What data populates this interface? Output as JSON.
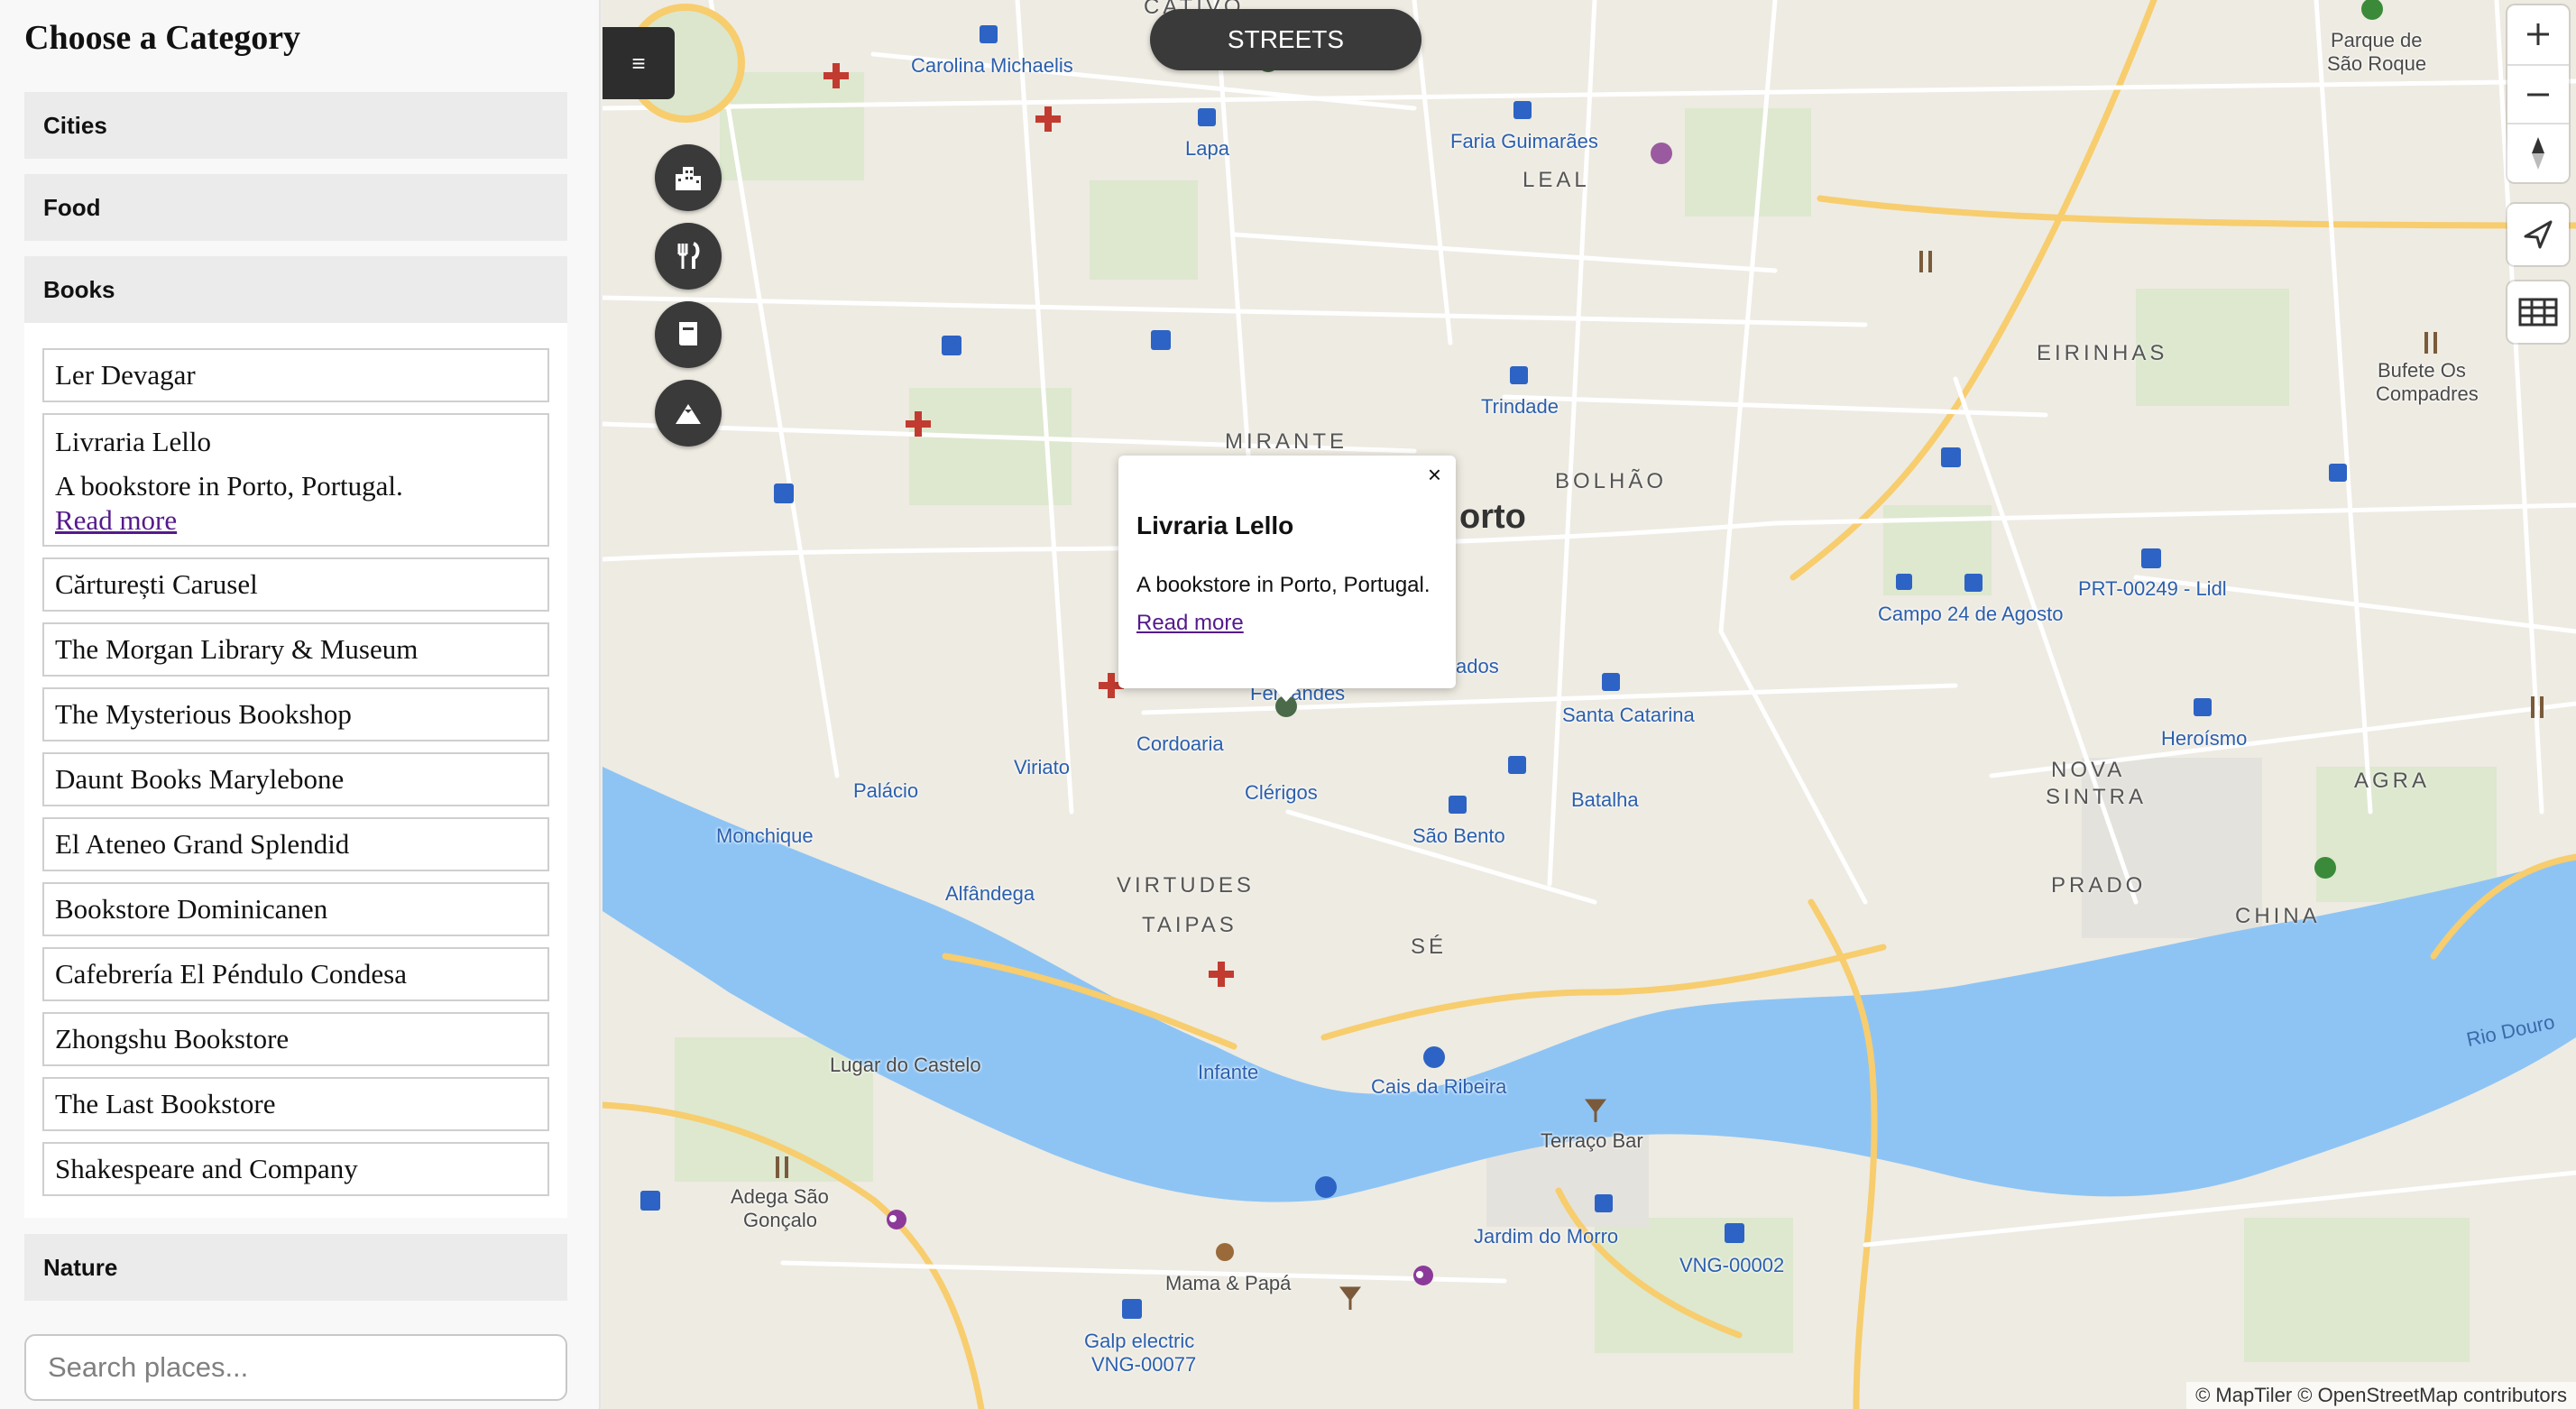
{
  "sidebar": {
    "title": "Choose a Category",
    "categories": {
      "cities": "Cities",
      "food": "Food",
      "books": "Books",
      "nature": "Nature"
    },
    "books": [
      {
        "name": "Ler Devagar"
      },
      {
        "name": "Livraria Lello",
        "description": "A bookstore in Porto, Portugal.",
        "link": "Read more"
      },
      {
        "name": "Cărturești Carusel"
      },
      {
        "name": "The Morgan Library & Museum"
      },
      {
        "name": "The Mysterious Bookshop"
      },
      {
        "name": "Daunt Books Marylebone"
      },
      {
        "name": "El Ateneo Grand Splendid"
      },
      {
        "name": "Bookstore Dominicanen"
      },
      {
        "name": "Cafebrería El Péndulo Condesa"
      },
      {
        "name": "Zhongshu Bookstore"
      },
      {
        "name": "The Last Bookstore"
      },
      {
        "name": "Shakespeare and Company"
      }
    ],
    "search_placeholder": "Search places..."
  },
  "map": {
    "style_button": "STREETS",
    "menu_icon": "hamburger-icon",
    "category_buttons": [
      "cities-icon",
      "food-icon",
      "books-icon",
      "nature-icon"
    ],
    "controls": [
      "zoom-in-icon",
      "zoom-out-icon",
      "compass-icon",
      "geolocate-icon",
      "grid-icon"
    ],
    "popup": {
      "title": "Livraria Lello",
      "description": "A bookstore in Porto, Portugal.",
      "link": "Read more",
      "close": "×"
    },
    "attribution": "© MapTiler © OpenStreetMap contributors",
    "labels": {
      "carolina": "Carolina Michaelis",
      "lapa": "Lapa",
      "faria": "Faria Guimarães",
      "leal": "LEAL",
      "parque": "Parque de",
      "saoroque": "São Roque",
      "eirinhas": "EIRINHAS",
      "bufete1": "Bufete Os",
      "bufete2": "Compadres",
      "trindade": "Trindade",
      "mirante": "MIRANTE",
      "bolhao": "BOLHÃO",
      "porto": "orto",
      "prt": "PRT-00249 - Lidl",
      "campo": "Campo 24 de Agosto",
      "aliados": "ados",
      "fernandes": "Fernandes",
      "santacat": "Santa Catarina",
      "heroismo": "Heroísmo",
      "novasintra1": "NOVA",
      "novasintra2": "SINTRA",
      "agra": "AGRA",
      "cordoaria": "Cordoaria",
      "viriato": "Viriato",
      "palacio": "Palácio",
      "clerigos": "Clérigos",
      "batalha": "Batalha",
      "monchique": "Monchique",
      "saobento": "São Bento",
      "alfandega": "Alfândega",
      "virtudes": "VIRTUDES",
      "taipas": "TAIPAS",
      "se": "SÉ",
      "prado": "PRADO",
      "china": "CHINA",
      "lugar": "Lugar do Castelo",
      "infante": "Infante",
      "cais": "Cais da Ribeira",
      "terraco": "Terraço Bar",
      "rio": "Rio Douro",
      "adega1": "Adega São",
      "adega2": "Gonçalo",
      "jardim": "Jardim do Morro",
      "vng2": "VNG-00002",
      "mama": "Mama & Papá",
      "galp1": "Galp electric",
      "galp2": "VNG-00077",
      "cativo": "CATIVO"
    }
  }
}
